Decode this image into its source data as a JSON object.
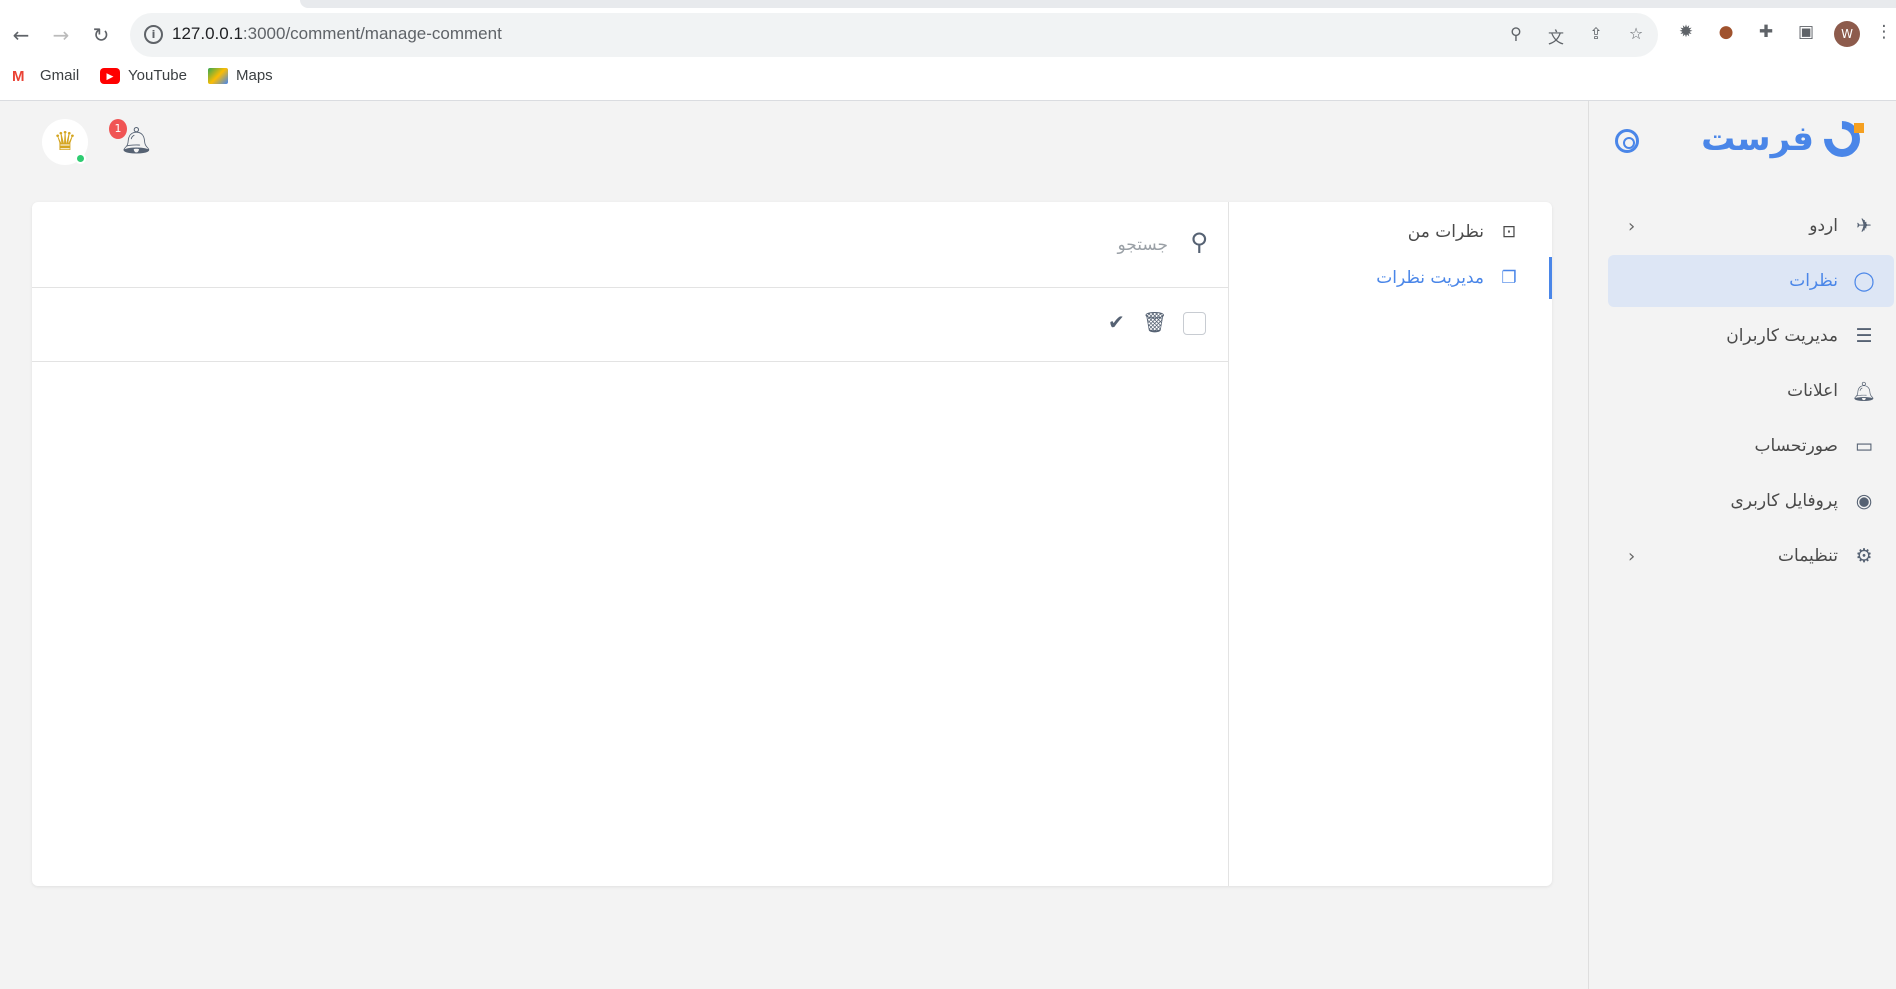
{
  "browser": {
    "url_host": "127.0.0.1",
    "url_path": ":3000/comment/manage-comment",
    "profile_initial": "W",
    "bookmarks": [
      {
        "label": "Gmail",
        "icon": "gmail-icon"
      },
      {
        "label": "YouTube",
        "icon": "youtube-icon"
      },
      {
        "label": "Maps",
        "icon": "maps-icon"
      }
    ]
  },
  "header": {
    "notification_count": "1"
  },
  "sidebar": {
    "logo_text": "فرست",
    "items": [
      {
        "label": "اردو",
        "icon": "plane-icon",
        "expandable": true
      },
      {
        "label": "نظرات",
        "icon": "chat-bubble-icon",
        "active": true
      },
      {
        "label": "مدیریت کاربران",
        "icon": "user-list-icon"
      },
      {
        "label": "اعلانات",
        "icon": "bell-icon"
      },
      {
        "label": "صورتحساب",
        "icon": "credit-card-icon"
      },
      {
        "label": "پروفایل کاربری",
        "icon": "user-circle-icon"
      },
      {
        "label": "تنظیمات",
        "icon": "gear-icon",
        "expandable": true
      }
    ]
  },
  "comments": {
    "submenu": [
      {
        "label": "نظرات من",
        "icon": "chat-dots-icon"
      },
      {
        "label": "مدیریت نظرات",
        "icon": "chats-icon",
        "active": true
      }
    ],
    "search_placeholder": "جستجو"
  },
  "colors": {
    "accent": "#4a86e8",
    "active_bg": "#dde6f5",
    "badge": "#f05454",
    "online": "#2ecc71"
  }
}
